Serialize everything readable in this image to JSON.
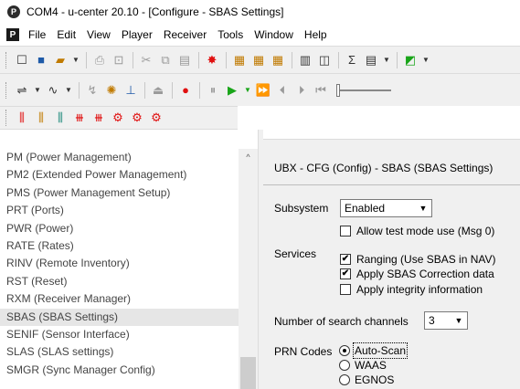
{
  "window": {
    "title": "COM4 - u-center 20.10 - [Configure - SBAS Settings]"
  },
  "menu": [
    "File",
    "Edit",
    "View",
    "Player",
    "Receiver",
    "Tools",
    "Window",
    "Help"
  ],
  "message_list": {
    "items": [
      "PM (Power Management)",
      "PM2 (Extended Power Management)",
      "PMS (Power Management Setup)",
      "PRT (Ports)",
      "PWR (Power)",
      "RATE (Rates)",
      "RINV (Remote Inventory)",
      "RST (Reset)",
      "RXM (Receiver Manager)",
      "SBAS (SBAS Settings)",
      "SENIF (Sensor Interface)",
      "SLAS (SLAS settings)",
      "SMGR (Sync Manager Config)"
    ],
    "selected": "SBAS (SBAS Settings)"
  },
  "config": {
    "header": "UBX - CFG (Config) - SBAS (SBAS Settings)",
    "subsystem_label": "Subsystem",
    "subsystem_value": "Enabled",
    "allow_test_mode": {
      "label": "Allow test mode use (Msg 0)",
      "checked": false
    },
    "services_label": "Services",
    "services": [
      {
        "label": "Ranging (Use SBAS in NAV)",
        "checked": true
      },
      {
        "label": "Apply SBAS Correction data",
        "checked": true
      },
      {
        "label": "Apply integrity information",
        "checked": false
      }
    ],
    "channels_label": "Number of search channels",
    "channels_value": "3",
    "prn_label": "PRN Codes",
    "prn_options": [
      {
        "label": "Auto-Scan",
        "selected": true
      },
      {
        "label": "WAAS",
        "selected": false
      },
      {
        "label": "EGNOS",
        "selected": false
      }
    ]
  },
  "icons": {
    "checkmark": "✔",
    "dropdown": "▼"
  }
}
